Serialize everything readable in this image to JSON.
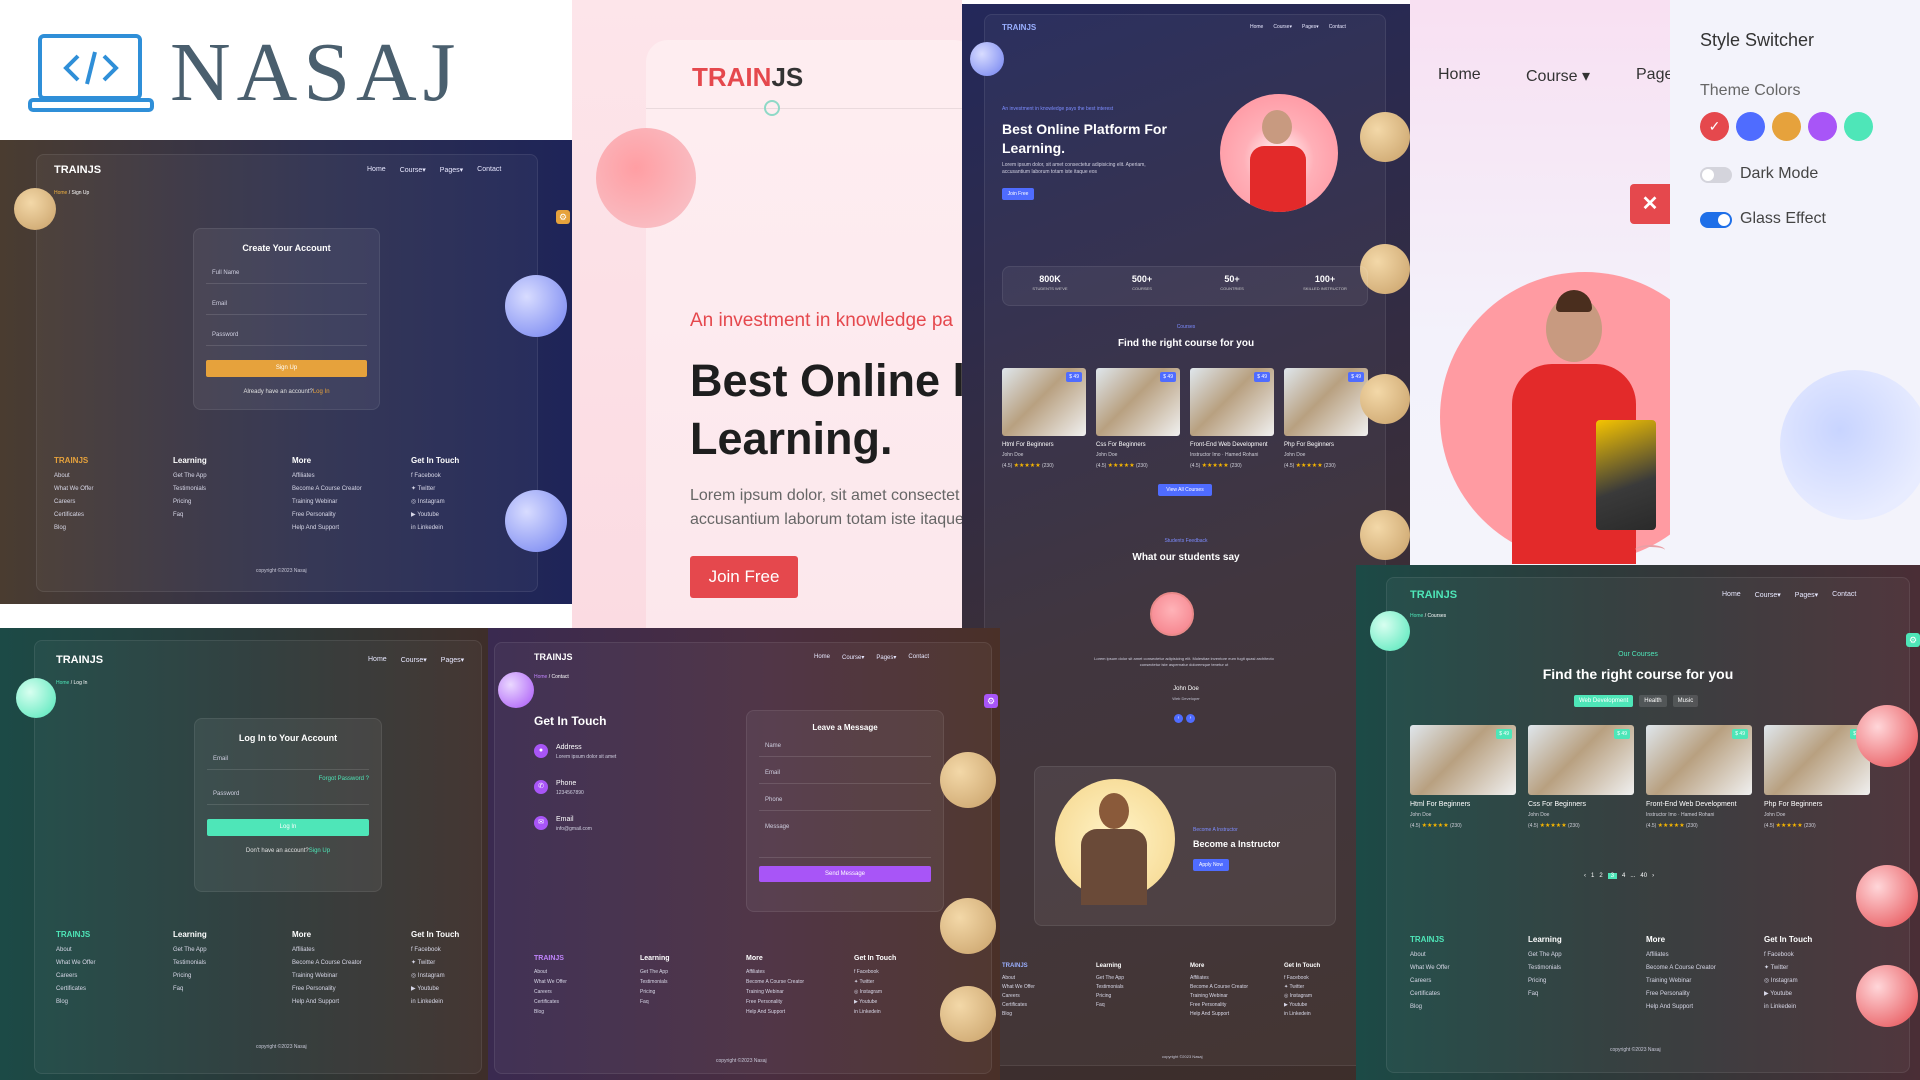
{
  "logo": {
    "text": "NASAJ"
  },
  "signup": {
    "brand": "TRAINJS",
    "nav": [
      "Home",
      "Course",
      "Pages",
      "Contact"
    ],
    "breadcrumb": [
      "Home",
      "Sign Up"
    ],
    "title": "Create Your Account",
    "fields": [
      "Full Name",
      "Email",
      "Password"
    ],
    "button": "Sign Up",
    "footer_text": "Already have an account?",
    "footer_link": "Log In"
  },
  "footer": {
    "brand": "TRAINJS",
    "col1": [
      "About",
      "What We Offer",
      "Careers",
      "Certificates",
      "Blog"
    ],
    "learning_title": "Learning",
    "col2": [
      "Get The App",
      "Testimonials",
      "Pricing",
      "Faq"
    ],
    "more_title": "More",
    "col3": [
      "Affiliates",
      "Become A Course Creator",
      "Training Webinar",
      "Free Personality",
      "Help And Support"
    ],
    "touch_title": "Get In Touch",
    "col4": [
      "Facebook",
      "Twitter",
      "Instagram",
      "Youtube",
      "Linkedein"
    ],
    "copyright": "copyright ©2023 Nasaj"
  },
  "hero_light": {
    "brand_a": "TRAIN",
    "brand_b": "JS",
    "tagline": "An investment in knowledge pa",
    "title_line1": "Best Online l",
    "title_line2": "Learning.",
    "desc_line1": "Lorem ipsum dolor, sit amet consectet",
    "desc_line2": "accusantium laborum totam iste itaque",
    "button": "Join Free"
  },
  "navlight": {
    "home": "Home",
    "course": "Course",
    "pages": "Page"
  },
  "switcher": {
    "title": "Style Switcher",
    "theme_label": "Theme Colors",
    "colors": [
      "#e5484d",
      "#4f6cff",
      "#e6a23c",
      "#a855f7",
      "#4ee6b8"
    ],
    "dark_label": "Dark Mode",
    "glass_label": "Glass Effect",
    "close": "✕"
  },
  "home_dark": {
    "brand": "TRAINJS",
    "nav": [
      "Home",
      "Course",
      "Pages",
      "Contact"
    ],
    "tagline": "An investment in knowledge pays the best interest",
    "title_line1": "Best Online Platform For",
    "title_line2": "Learning.",
    "desc": "Lorem ipsum dolor, sit amet consectetur adipisicing elit. Aperiam, accusantium laborum totam iste itaque eos",
    "button": "Join Free",
    "stats": [
      {
        "n": "800K",
        "l": "STUDENTS WE'VE"
      },
      {
        "n": "500+",
        "l": "COURSES"
      },
      {
        "n": "50+",
        "l": "COUNTRIES"
      },
      {
        "n": "100+",
        "l": "SKILLED INSTRUCTOR"
      }
    ],
    "courses_tag": "Courses",
    "courses_title": "Find the right course for you",
    "courses": [
      {
        "title": "Html For Beginners",
        "author": "John Doe",
        "rating": "(4.5)",
        "count": "(230)",
        "price": "$ 49"
      },
      {
        "title": "Css For Beginners",
        "author": "John Doe",
        "rating": "(4.5)",
        "count": "(230)",
        "price": "$ 49"
      },
      {
        "title": "Front-End Web Development",
        "author": "Instructor Imo · Hamed Rohani",
        "rating": "(4.5)",
        "count": "(230)",
        "price": "$ 49"
      },
      {
        "title": "Php For Beginners",
        "author": "John Doe",
        "rating": "(4.5)",
        "count": "(230)",
        "price": "$ 49"
      }
    ],
    "view_all": "View All Courses",
    "feedback_tag": "Students Feedback",
    "feedback_title": "What our students say",
    "quote": "Lorem ipsum dolor sit amet consectetur adipisicing elit. Molestiae inventore eum fugit quasi architecto consectetur iste aspernatur doloremque tenetur ut",
    "person": "John Doe",
    "role": "Web Developer",
    "instructor_tag": "Become A Instructor",
    "instructor_title": "Become a Instructor",
    "instructor_button": "Apply Now"
  },
  "login": {
    "brand": "TRAINJS",
    "nav": [
      "Home",
      "Course",
      "Pages"
    ],
    "breadcrumb": [
      "Home",
      "Log In"
    ],
    "title": "Log In to Your Account",
    "email": "Email",
    "forgot": "Forgot Password ?",
    "password": "Password",
    "button": "Log In",
    "footer_text": "Don't have an account?",
    "footer_link": "Sign Up"
  },
  "contact": {
    "brand": "TRAINJS",
    "nav": [
      "Home",
      "Course",
      "Pages",
      "Contact"
    ],
    "breadcrumb": [
      "Home",
      "Contact"
    ],
    "title": "Get In Touch",
    "address_label": "Address",
    "address_value": "Lorem ipsum dolor sit amet",
    "phone_label": "Phone",
    "phone_value": "1234567890",
    "email_label": "Email",
    "email_value": "info@gmail.com",
    "form_title": "Leave a Message",
    "form_fields": [
      "Name",
      "Email",
      "Phone",
      "Message"
    ],
    "button": "Send Message"
  },
  "courses_page": {
    "brand": "TRAINJS",
    "nav": [
      "Home",
      "Course",
      "Pages",
      "Contact"
    ],
    "breadcrumb": [
      "Home",
      "Courses"
    ],
    "tag": "Our Courses",
    "title": "Find the right course for you",
    "filters": [
      "Web Development",
      "Health",
      "Music"
    ],
    "pagination": [
      "‹",
      "1",
      "2",
      "3",
      "4",
      "...",
      "40",
      "›"
    ]
  }
}
